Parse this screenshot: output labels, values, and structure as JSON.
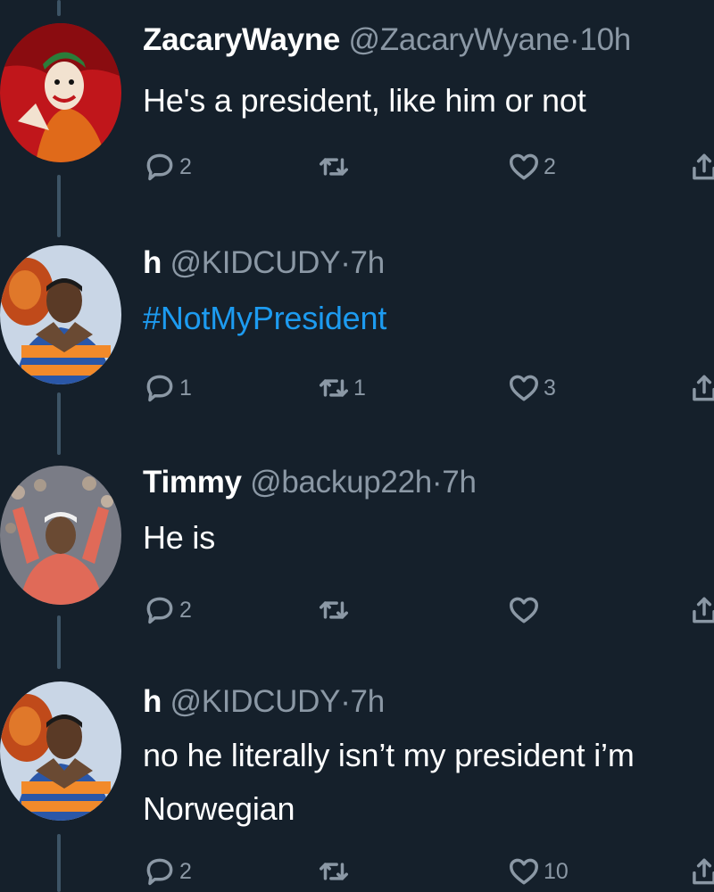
{
  "colors": {
    "background": "#15202b",
    "text": "#ffffff",
    "secondary": "#8b98a5",
    "link": "#1d9bf0",
    "thread_line": "#3d5466"
  },
  "icons": {
    "reply": "reply-icon",
    "retweet": "retweet-icon",
    "like": "heart-icon",
    "share": "share-icon"
  },
  "tweets": [
    {
      "name": "ZacaryWayne",
      "handle": "@ZacaryWyane",
      "dot": "·",
      "time": "10h",
      "text": "He's a president, like him or not",
      "replies": "2",
      "retweets": "",
      "likes": "2"
    },
    {
      "name": "h",
      "handle": "@KIDCUDY",
      "dot": "·",
      "time": "7h",
      "text": "#NotMyPresident",
      "replies": "1",
      "retweets": "1",
      "likes": "3"
    },
    {
      "name": "Timmy",
      "handle": "@backup22h",
      "dot": "·",
      "time": "7h",
      "text": "He is",
      "replies": "2",
      "retweets": "",
      "likes": ""
    },
    {
      "name": "h",
      "handle": "@KIDCUDY",
      "dot": "·",
      "time": "7h",
      "text_line1": "no he literally isn’t my president i’m",
      "text_line2": "Norwegian",
      "replies": "2",
      "retweets": "",
      "likes": "10"
    }
  ]
}
